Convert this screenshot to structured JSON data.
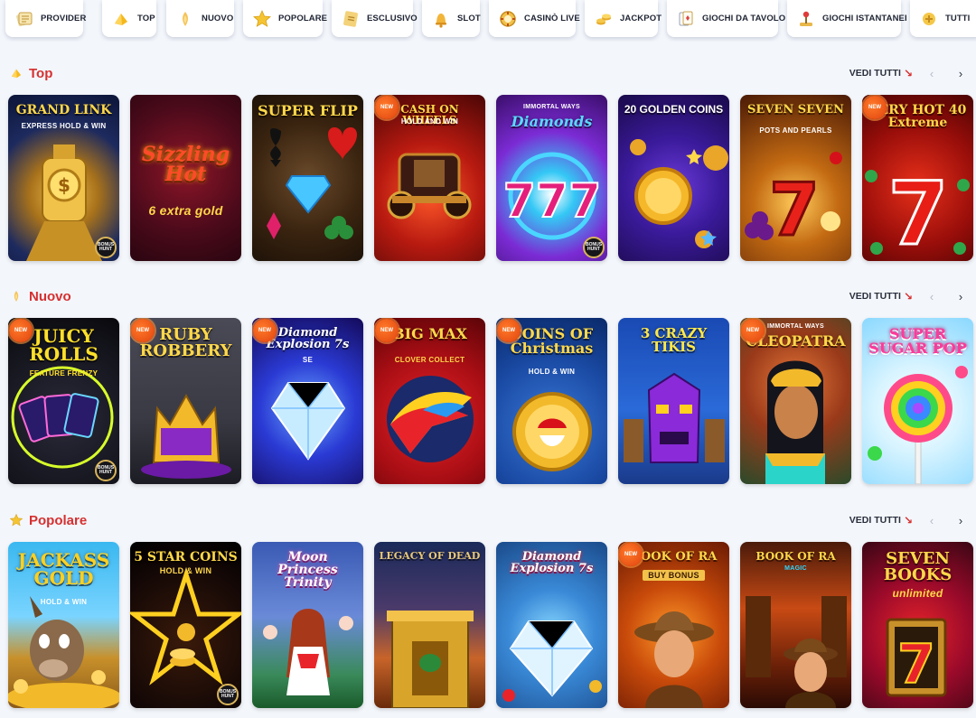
{
  "categories": [
    {
      "label": "PROVIDER",
      "icon": "provider-icon"
    },
    {
      "label": "TOP",
      "icon": "top-icon"
    },
    {
      "label": "NUOVO",
      "icon": "nuovo-icon"
    },
    {
      "label": "POPOLARE",
      "icon": "popolare-star-icon"
    },
    {
      "label": "ESCLUSIVO",
      "icon": "esclusivo-icon"
    },
    {
      "label": "SLOT",
      "icon": "slot-bell-icon"
    },
    {
      "label": "CASINÒ LIVE",
      "icon": "casino-live-chip-icon"
    },
    {
      "label": "JACKPOT",
      "icon": "jackpot-coins-icon"
    },
    {
      "label": "GIOCHI DA TAVOLO",
      "icon": "table-games-icon"
    },
    {
      "label": "GIOCHI ISTANTANEI",
      "icon": "instant-games-joystick-icon"
    },
    {
      "label": "TUTTI",
      "icon": "all-games-icon"
    }
  ],
  "colors": {
    "accent": "#d63030",
    "background": "#f3f6fb",
    "badge_new": "#e0420d"
  },
  "sections": [
    {
      "title": "Top",
      "icon": "top-icon",
      "see_all": "VEDI TUTTI",
      "tiles": [
        {
          "title": "GRAND LINK",
          "subtitle": "EXPRESS HOLD & WIN",
          "new": false,
          "hunt": true
        },
        {
          "title": "Sizzling Hot",
          "subtitle": "6 extra gold",
          "new": false,
          "hunt": false
        },
        {
          "title": "SUPER FLIP",
          "subtitle": "",
          "new": false,
          "hunt": false
        },
        {
          "title": "CASH ON WHEELS",
          "subtitle": "HOLD AND WIN",
          "new": true,
          "hunt": false
        },
        {
          "title": "Diamonds",
          "subtitle": "IMMORTAL WAYS",
          "new": false,
          "hunt": true
        },
        {
          "title": "20 GOLDEN COINS",
          "subtitle": "",
          "new": false,
          "hunt": false
        },
        {
          "title": "SEVEN SEVEN",
          "subtitle": "POTS AND PEARLS",
          "new": false,
          "hunt": false
        },
        {
          "title": "VERY HOT 40 Extreme",
          "subtitle": "",
          "new": true,
          "hunt": false
        }
      ]
    },
    {
      "title": "Nuovo",
      "icon": "nuovo-icon",
      "see_all": "VEDI TUTTI",
      "tiles": [
        {
          "title": "JUICY ROLLS",
          "subtitle": "FEATURE FRENZY",
          "new": true,
          "hunt": true
        },
        {
          "title": "RUBY ROBBERY",
          "subtitle": "",
          "new": true,
          "hunt": false
        },
        {
          "title": "Diamond Explosion 7s",
          "subtitle": "SE",
          "new": true,
          "hunt": false
        },
        {
          "title": "BIG MAX",
          "subtitle": "CLOVER COLLECT",
          "new": true,
          "hunt": false
        },
        {
          "title": "COINS OF Christmas",
          "subtitle": "HOLD & WIN",
          "new": true,
          "hunt": false
        },
        {
          "title": "3 CRAZY TIKIS",
          "subtitle": "",
          "new": false,
          "hunt": false
        },
        {
          "title": "CLEOPATRA",
          "subtitle": "IMMORTAL WAYS",
          "new": true,
          "hunt": false
        },
        {
          "title": "SUPER SUGAR POP",
          "subtitle": "",
          "new": false,
          "hunt": false
        }
      ]
    },
    {
      "title": "Popolare",
      "icon": "popolare-star-icon",
      "see_all": "VEDI TUTTI",
      "tiles": [
        {
          "title": "JACKASS GOLD",
          "subtitle": "HOLD & WIN",
          "new": false,
          "hunt": false
        },
        {
          "title": "5 STAR COINS",
          "subtitle": "HOLD & WIN",
          "new": false,
          "hunt": true
        },
        {
          "title": "Moon Princess Trinity",
          "subtitle": "",
          "new": false,
          "hunt": false
        },
        {
          "title": "LEGACY OF DEAD",
          "subtitle": "",
          "new": false,
          "hunt": false
        },
        {
          "title": "Diamond Explosion 7s",
          "subtitle": "",
          "new": false,
          "hunt": false
        },
        {
          "title": "BOOK OF RA",
          "subtitle": "BUY BONUS",
          "new": true,
          "hunt": false
        },
        {
          "title": "BOOK OF RA",
          "subtitle": "MAGIC",
          "new": false,
          "hunt": false
        },
        {
          "title": "SEVEN BOOKS",
          "subtitle": "unlimited",
          "new": false,
          "hunt": false
        }
      ]
    }
  ],
  "badges": {
    "new": "NEW",
    "hunt": "BONUS HUNT"
  }
}
